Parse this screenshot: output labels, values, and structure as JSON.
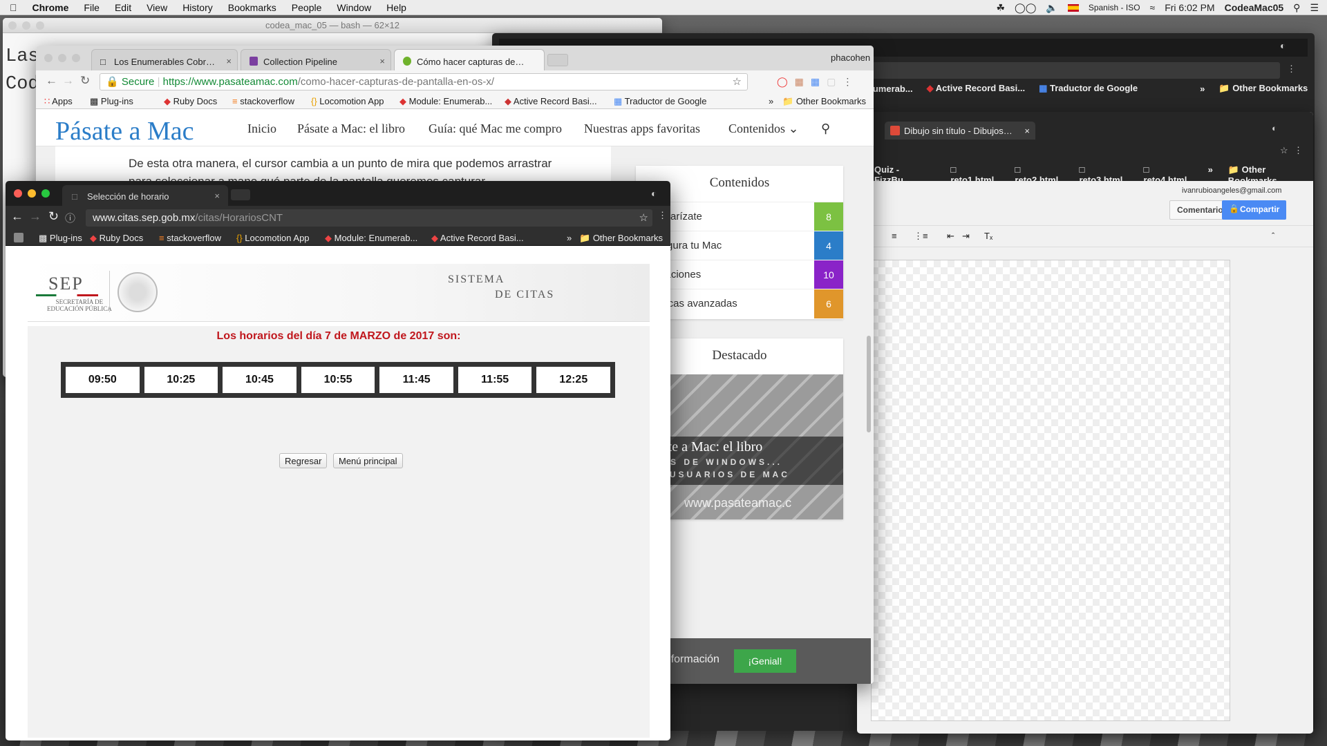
{
  "menubar": {
    "app": "Chrome",
    "items": [
      "File",
      "Edit",
      "View",
      "History",
      "Bookmarks",
      "People",
      "Window",
      "Help"
    ],
    "input_source": "Spanish - ISO",
    "clock": "Fri 6:02 PM",
    "user": "CodeaMac05"
  },
  "terminal": {
    "title": "codea_mac_05 — bash — 62×12",
    "lines": [
      "Las",
      "Cod"
    ]
  },
  "back_chrome": {
    "bookmarks": [
      "...umerab...",
      "Active Record Basi...",
      "Traductor de Google",
      "»",
      "Other Bookmarks"
    ],
    "drawing_tab": "Dibujo sin título - Dibujos de G",
    "drawing_bookmarks": [
      "Quiz - FizzBu...",
      "reto1.html",
      "reto2.html",
      "reto3.html",
      "reto4.html",
      "»",
      "Other Bookmarks"
    ],
    "account": "ivanrubioangeles@gmail.com",
    "comments_label": "Comentarios",
    "share_label": "Compartir"
  },
  "pasateamac": {
    "profile": "phacohen",
    "tabs": [
      {
        "title": "Los Enumerables Cobran Vida"
      },
      {
        "title": "Collection Pipeline"
      },
      {
        "title": "Cómo hacer capturas de pant"
      }
    ],
    "secure_label": "Secure",
    "url_host": "https://www.pasateamac.com",
    "url_path": "/como-hacer-capturas-de-pantalla-en-os-x/",
    "bookmarks": [
      "Apps",
      "Plug-ins",
      "Ruby Docs",
      "stackoverflow",
      "Locomotion App",
      "Module: Enumerab...",
      "Active Record Basi...",
      "Traductor de Google",
      "»",
      "Other Bookmarks"
    ],
    "site": {
      "logo": "Pásate a Mac",
      "nav": [
        "Inicio",
        "Pásate a Mac: el libro",
        "Guía: qué Mac me compro",
        "Nuestras apps favoritas",
        "Contenidos ⌄"
      ],
      "article_text": "De esta otra manera, el cursor cambia a un punto de mira que podemos arrastrar para seleccionar a mano qué parte de la pantalla queremos capturar.",
      "toc_title": "Contenidos",
      "toc": [
        {
          "label": "Familiarízate",
          "count": "8",
          "color": "#7cc142"
        },
        {
          "label": "Configura tu Mac",
          "count": "4",
          "color": "#2b7dc8"
        },
        {
          "label": "Aplicaciones",
          "count": "10",
          "color": "#8a23c8"
        },
        {
          "label": "Técnicas avanzadas",
          "count": "6",
          "color": "#e0962b"
        }
      ],
      "featured_title": "Destacado",
      "featured_caption": "Pásate a Mac: el libro",
      "featured_lines": [
        "ARIOS DE WINDOWS...",
        "ARA USUARIOS DE MAC",
        "www.pasateamac.c"
      ],
      "cookie_text": "kies. Información",
      "cookie_button": "¡Genial!"
    }
  },
  "citas": {
    "tab_title": "Selección de horario",
    "url_host": "www.citas.sep.gob.mx",
    "url_path": "/citas/HorariosCNT",
    "bookmarks": [
      "Plug-ins",
      "Ruby Docs",
      "stackoverflow",
      "Locomotion App",
      "Module: Enumerab...",
      "Active Record Basi...",
      "»",
      "Other Bookmarks"
    ],
    "sep_logo": "SEP",
    "sep_sub1": "SECRETARÍA DE",
    "sep_sub2": "EDUCACIÓN PÚBLICA",
    "system_line1": "SISTEMA",
    "system_line2": "DE CITAS",
    "heading": "Los horarios del día 7 de MARZO de 2017 son:",
    "slots": [
      "09:50",
      "10:25",
      "10:45",
      "10:55",
      "11:45",
      "11:55",
      "12:25"
    ],
    "back_button": "Regresar",
    "menu_button": "Menú principal"
  }
}
